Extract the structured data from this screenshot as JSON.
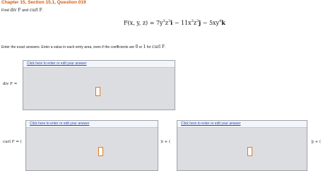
{
  "header": {
    "title": "Chapter 15, Section 15.1, Question 019"
  },
  "prompt": {
    "find": "Find",
    "div_expr": "div F",
    "and": "and",
    "curl_expr": "curl F",
    "end": "."
  },
  "equation": {
    "lhs": "F(x, y, z) = 7y",
    "t1_exp_y": "3",
    "t1_mid": "z",
    "t1_exp_z": "3",
    "t1_unit": "i",
    "t2_coef": " − 11x",
    "t2_exp_x": "3",
    "t2_mid": "z",
    "t2_exp_z": "3",
    "t2_unit": "j",
    "t3_coef": " − 5xy",
    "t3_exp_y": "4",
    "t3_unit": "k"
  },
  "instructions": {
    "text": "Enter the exact answers. Enter a value in each entry area, even if the coefficients are",
    "zero": "0",
    "or": "or",
    "one": "1",
    "for": "for",
    "curl": "curl F",
    "end": "."
  },
  "div_row": {
    "label": "div F =",
    "link": "Click here to enter or edit your answer"
  },
  "curl_row": {
    "label": "curl F = (",
    "link1": "Click here to enter or edit your answer",
    "sep1": ")i + (",
    "link2": "Click here to enter or edit your answer",
    "sep2": ")j + ("
  },
  "colors": {
    "header": "#d05a10",
    "link": "#2a49b6",
    "box_bg": "#dcdde0",
    "cursor": "#e07b20"
  }
}
